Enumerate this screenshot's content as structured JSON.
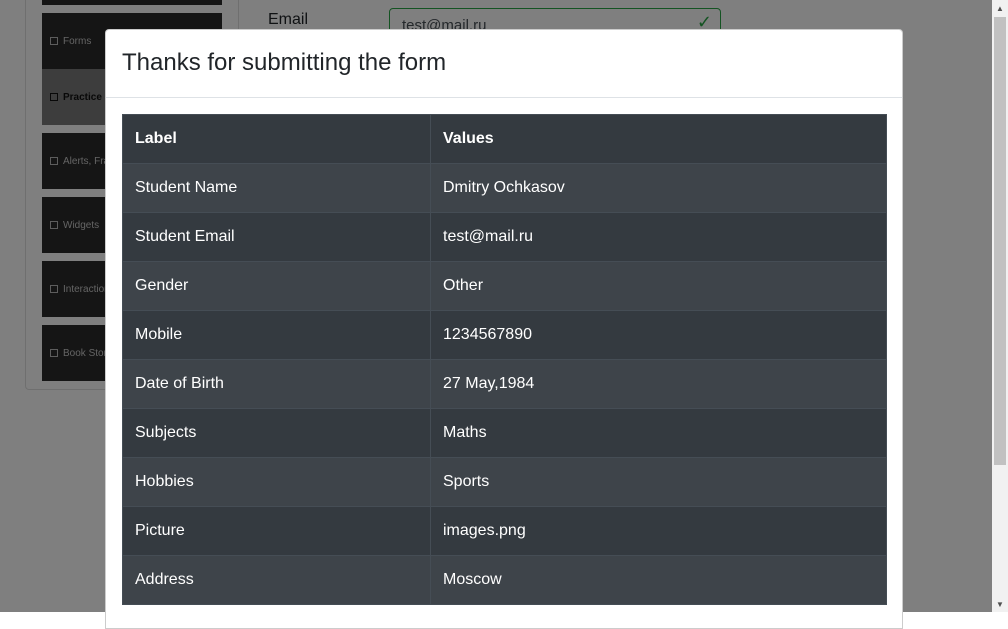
{
  "background_page": {
    "sidebar": {
      "items": [
        {
          "label": "Forms",
          "icon": "document-icon"
        },
        {
          "label": "Practice Form",
          "icon": "html5-icon"
        },
        {
          "label": "Alerts, Frame & Windows",
          "icon": "window-icon"
        },
        {
          "label": "Widgets",
          "icon": "grid-icon"
        },
        {
          "label": "Interactions",
          "icon": "list-icon"
        },
        {
          "label": "Book Store Application",
          "icon": "book-icon"
        }
      ]
    },
    "email_label": "Email",
    "email_value": "test@mail.ru"
  },
  "modal": {
    "title": "Thanks for submitting the form",
    "table": {
      "headers": [
        "Label",
        "Values"
      ],
      "rows": [
        {
          "label": "Student Name",
          "value": "Dmitry Ochkasov"
        },
        {
          "label": "Student Email",
          "value": "test@mail.ru"
        },
        {
          "label": "Gender",
          "value": "Other"
        },
        {
          "label": "Mobile",
          "value": "1234567890"
        },
        {
          "label": "Date of Birth",
          "value": "27 May,1984"
        },
        {
          "label": "Subjects",
          "value": "Maths"
        },
        {
          "label": "Hobbies",
          "value": "Sports"
        },
        {
          "label": "Picture",
          "value": "images.png"
        },
        {
          "label": "Address",
          "value": "Moscow"
        }
      ]
    }
  },
  "colors": {
    "table_dark": "#343a40",
    "table_striped": "#3e444a",
    "valid_green": "#28a745"
  }
}
